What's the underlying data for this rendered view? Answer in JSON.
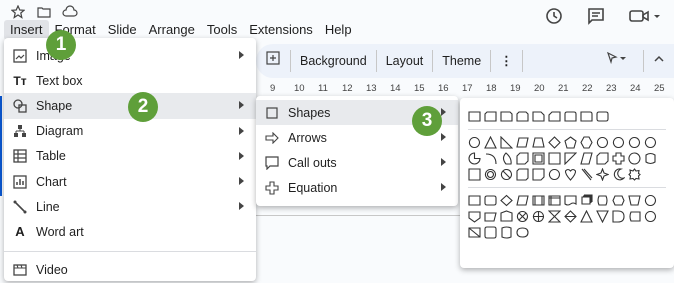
{
  "top_icons": [
    "star-icon",
    "move-to-folder-icon",
    "cloud-status-icon"
  ],
  "menubar": [
    "Insert",
    "Format",
    "Slide",
    "Arrange",
    "Tools",
    "Extensions",
    "Help"
  ],
  "right_icons": [
    "history-icon",
    "comment-icon",
    "camera-icon"
  ],
  "toolbar": {
    "background": "Background",
    "layout": "Layout",
    "theme": "Theme"
  },
  "ruler": [
    "9",
    "10",
    "11",
    "12",
    "13",
    "14",
    "15",
    "16",
    "17",
    "18",
    "19",
    "20",
    "21",
    "22",
    "23",
    "24",
    "25"
  ],
  "insert_menu": {
    "items": [
      {
        "label": "Image",
        "icon": "image-icon",
        "submenu": true
      },
      {
        "label": "Text box",
        "icon": "text-box-icon",
        "submenu": false
      },
      {
        "label": "Shape",
        "icon": "shape-icon",
        "submenu": true
      },
      {
        "label": "Diagram",
        "icon": "diagram-icon",
        "submenu": true
      },
      {
        "label": "Table",
        "icon": "table-icon",
        "submenu": true
      },
      {
        "label": "Chart",
        "icon": "chart-icon",
        "submenu": true
      },
      {
        "label": "Line",
        "icon": "line-icon",
        "submenu": true
      },
      {
        "label": "Word art",
        "icon": "word-art-icon",
        "submenu": false
      },
      {
        "label": "Video",
        "icon": "video-icon",
        "submenu": false
      }
    ]
  },
  "shape_menu": {
    "items": [
      {
        "label": "Shapes",
        "icon": "square-icon"
      },
      {
        "label": "Arrows",
        "icon": "arrow-icon"
      },
      {
        "label": "Call outs",
        "icon": "callout-icon"
      },
      {
        "label": "Equation",
        "icon": "plus-icon"
      }
    ]
  },
  "badges": [
    "1",
    "2",
    "3"
  ],
  "colors": {
    "badge": "#5f9f3a",
    "accent": "#0b57d0",
    "toolbar_bg": "#edf2fa"
  }
}
